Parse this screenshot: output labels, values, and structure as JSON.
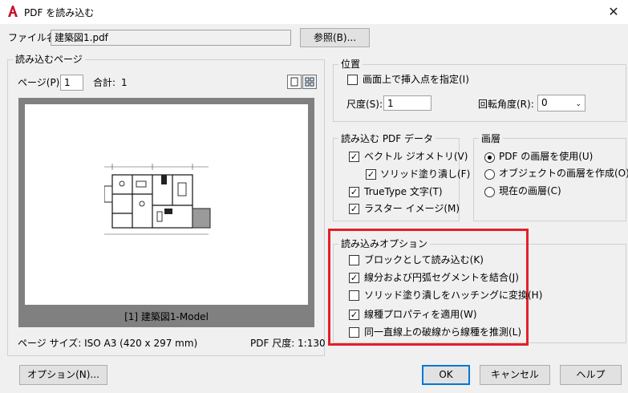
{
  "window": {
    "title": "PDF を読み込む",
    "close_glyph": "✕"
  },
  "file": {
    "label": "ファイル名:",
    "value": "建築図1.pdf",
    "browse_button": "参照(B)..."
  },
  "pages": {
    "group_title": "読み込むページ",
    "page_label": "ページ(P):",
    "page_value": "1",
    "total_label": "合計:",
    "total_value": "1",
    "preview_caption": "[1] 建築図1-Model",
    "page_size": "ページ サイズ: ISO A3 (420 x 297 mm)",
    "pdf_scale": "PDF 尺度: 1:130"
  },
  "position": {
    "group_title": "位置",
    "specify_on_screen": "画面上で挿入点を指定(I)",
    "specify_on_screen_checked": false,
    "scale_label": "尺度(S):",
    "scale_value": "1",
    "rotation_label": "回転角度(R):",
    "rotation_value": "0"
  },
  "pdf_data": {
    "group_title": "読み込む PDF データ",
    "items": [
      {
        "label": "ベクトル ジオメトリ(V)",
        "checked": true
      },
      {
        "label": "ソリッド塗り潰し(F)",
        "checked": true
      },
      {
        "label": "TrueType 文字(T)",
        "checked": true
      },
      {
        "label": "ラスター イメージ(M)",
        "checked": true
      }
    ]
  },
  "layers": {
    "group_title": "画層",
    "options": [
      {
        "label": "PDF の画層を使用(U)",
        "selected": true
      },
      {
        "label": "オブジェクトの画層を作成(O)",
        "selected": false
      },
      {
        "label": "現在の画層(C)",
        "selected": false
      }
    ]
  },
  "import_options": {
    "group_title": "読み込みオプション",
    "items": [
      {
        "label": "ブロックとして読み込む(K)",
        "checked": false
      },
      {
        "label": "線分および円弧セグメントを結合(J)",
        "checked": true
      },
      {
        "label": "ソリッド塗り潰しをハッチングに変換(H)",
        "checked": false
      },
      {
        "label": "線種プロパティを適用(W)",
        "checked": true
      },
      {
        "label": "同一直線上の破線から線種を推測(L)",
        "checked": false
      }
    ],
    "highlight_color": "#e3202a"
  },
  "buttons": {
    "options": "オプション(N)...",
    "ok": "OK",
    "cancel": "キャンセル",
    "help": "ヘルプ"
  },
  "colors": {
    "accent": "#0078d7",
    "app_icon": "#c8102e"
  },
  "icons": {
    "app": "autocad-a-icon",
    "single_view": "single-page-view-icon",
    "grid_view": "thumbnail-grid-view-icon"
  }
}
